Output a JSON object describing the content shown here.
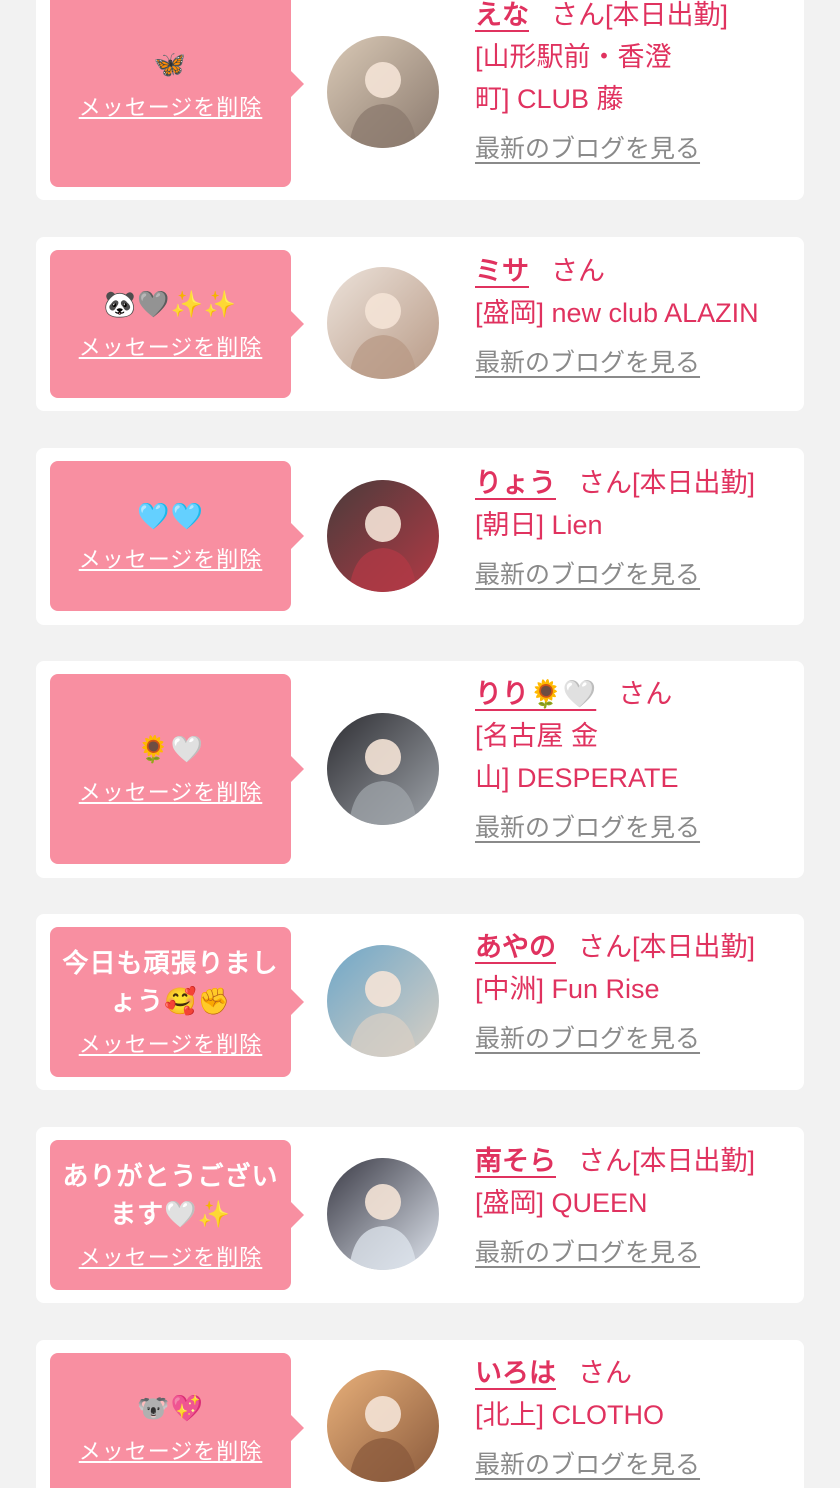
{
  "cards": [
    {
      "message": "🦋",
      "delete_label": "メッセージを削除",
      "name": "えな",
      "honorific": "さん",
      "status": "[本日出勤]",
      "shop_lines": [
        "[山形駅前・香澄",
        "町] CLUB 藤"
      ],
      "blog_label": "最新のブログを見る",
      "avatar_colors": [
        "#8b7a6e",
        "#d9c9b6"
      ]
    },
    {
      "message": "🐼🩶✨✨",
      "delete_label": "メッセージを削除",
      "name": "ミサ",
      "honorific": "さん",
      "status": "",
      "shop_lines": [
        "[盛岡] new club ALAZIN"
      ],
      "blog_label": "最新のブログを見る",
      "avatar_colors": [
        "#b89a86",
        "#ece2da"
      ]
    },
    {
      "message": "🩵🩵",
      "delete_label": "メッセージを削除",
      "name": "りょう",
      "honorific": "さん",
      "status": "[本日出勤]",
      "shop_lines": [
        "[朝日] Lien"
      ],
      "blog_label": "最新のブログを見る",
      "avatar_colors": [
        "#b23a45",
        "#4a3b3b"
      ]
    },
    {
      "message": "🌻🤍",
      "delete_label": "メッセージを削除",
      "name": "りり🌻🤍",
      "honorific": "さん",
      "status": "",
      "shop_lines": [
        "[名古屋 金",
        "山] DESPERATE"
      ],
      "blog_label": "最新のブログを見る",
      "avatar_colors": [
        "#9fa4aa",
        "#2e2e33"
      ]
    },
    {
      "message": "今日も頑張りましょう🥰✊",
      "delete_label": "メッセージを削除",
      "name": "あやの",
      "honorific": "さん",
      "status": "[本日出勤]",
      "shop_lines": [
        "[中洲] Fun Rise"
      ],
      "blog_label": "最新のブログを見る",
      "avatar_colors": [
        "#d8cfc4",
        "#6fa7c8"
      ]
    },
    {
      "message": "ありがとうございます🤍✨",
      "delete_label": "メッセージを削除",
      "name": "南そら",
      "honorific": "さん",
      "status": "[本日出勤]",
      "shop_lines": [
        "[盛岡] QUEEN"
      ],
      "blog_label": "最新のブログを見る",
      "avatar_colors": [
        "#dfe5ee",
        "#3a3a45"
      ]
    },
    {
      "message": "🐨💖",
      "delete_label": "メッセージを削除",
      "name": "いろは",
      "honorific": "さん",
      "status": "",
      "shop_lines": [
        "[北上] CLOTHO"
      ],
      "blog_label": "最新のブログを見る",
      "avatar_colors": [
        "#8a5a3c",
        "#e8b07a"
      ]
    }
  ]
}
